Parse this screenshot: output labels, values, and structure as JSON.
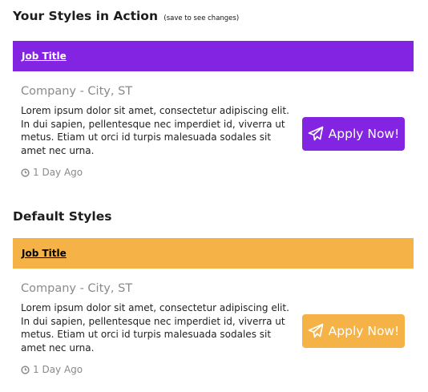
{
  "colors": {
    "custom_accent": "#8324e3",
    "default_accent": "#f5b347",
    "custom_title_text": "#ffffff",
    "default_title_text": "#000000",
    "muted_text": "#8a8a8a"
  },
  "custom_section": {
    "heading": "Your Styles in Action",
    "note": "(save to see changes)",
    "job": {
      "title": "Job Title",
      "company_location": "Company - City, ST",
      "description": "Lorem ipsum dolor sit amet, consectetur adipiscing elit. In dui sapien, pellentesque nec imperdiet id, viverra ut metus. Etiam ut orci id turpis malesuada sodales sit amet nec urna.",
      "posted": "1 Day Ago",
      "posted_icon": "clock-icon",
      "apply_label": "Apply Now!",
      "apply_icon": "paper-plane-icon"
    }
  },
  "default_section": {
    "heading": "Default Styles",
    "job": {
      "title": "Job Title",
      "company_location": "Company - City, ST",
      "description": "Lorem ipsum dolor sit amet, consectetur adipiscing elit. In dui sapien, pellentesque nec imperdiet id, viverra ut metus. Etiam ut orci id turpis malesuada sodales sit amet nec urna.",
      "posted": "1 Day Ago",
      "posted_icon": "clock-icon",
      "apply_label": "Apply Now!",
      "apply_icon": "paper-plane-icon"
    }
  }
}
